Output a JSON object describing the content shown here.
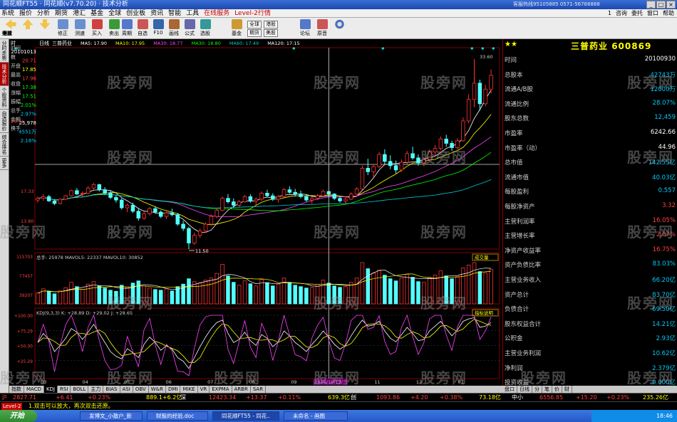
{
  "titlebar": {
    "title": "同花顺FT55 · 同花顺(v7.70.20) · 技术分析",
    "right_text": "客服热线95105885 0571-56768888",
    "min": "_",
    "max": "□",
    "close": "×"
  },
  "menubar": {
    "items": [
      "系统",
      "报价",
      "分析",
      "期货",
      "港汇",
      "基金",
      "全球",
      "创业板",
      "资讯",
      "智能",
      "工具",
      "在线服务",
      "Level-2行情"
    ],
    "right": [
      "1",
      "咨询",
      "委托",
      "窗口",
      "帮助"
    ]
  },
  "toolbar": {
    "buttons": [
      "修正",
      "测速",
      "买入",
      "卖出",
      "周期",
      "自选",
      "F10",
      "画线",
      "公式",
      "选股",
      "",
      "基金",
      "全球",
      "期货",
      "港股",
      "美股",
      "",
      "论坛",
      "原音"
    ],
    "small_pairs": [
      [
        "全球",
        "期货"
      ],
      [
        "港股",
        "美股"
      ]
    ]
  },
  "leftstrip": {
    "tabs": [
      "分时走势",
      "技术分析",
      "个股资料",
      "自选报价",
      "综合排名",
      "更多"
    ]
  },
  "chart": {
    "top_label": "时",
    "period_label": "日线",
    "stock_label": "三普药业",
    "ma_legend": [
      {
        "text": "MA5: 17.90",
        "color": "#ffffff"
      },
      {
        "text": "MA10: 17.95",
        "color": "#ffff00"
      },
      {
        "text": "MA30: 18.77",
        "color": "#ff44ff"
      },
      {
        "text": "MA30: 18.80",
        "color": "#00ff00"
      },
      {
        "text": "MA60: 17.49",
        "color": "#00cccc"
      },
      {
        "text": "MA120: 17:15",
        "color": "#ffffff"
      }
    ],
    "price_hi_label": "33.60",
    "price_axis": [
      "20.71",
      "17.33",
      "13.80"
    ],
    "low_marker": "11.50",
    "info_column": [
      {
        "label": "时间",
        "value": "20101013",
        "color": "#ffffff"
      },
      {
        "label": "数",
        "value": "20.71",
        "color": "#ff4040"
      },
      {
        "label": "开盘",
        "value": "17.85",
        "color": "#ffff00"
      },
      {
        "label": "最高",
        "value": "17.96",
        "color": "#ff4040"
      },
      {
        "label": "收盘",
        "value": "17.38",
        "color": "#00ff00"
      },
      {
        "label": "涨幅",
        "value": "17.51",
        "color": "#00ff00"
      },
      {
        "label": "振幅",
        "value": "2.01%",
        "color": "#00ff00"
      },
      {
        "label": "总手",
        "value": "2.97%",
        "color": "#00ccff"
      },
      {
        "label": "金额",
        "value": "25,978",
        "color": "#ffffff"
      },
      {
        "label": "换手",
        "value": "4551万",
        "color": "#00ccff"
      },
      {
        "label": "",
        "value": "2.16%",
        "color": "#00ccff"
      }
    ],
    "volume": {
      "legend": "总手: 25978 MAVOL5: 22337 MAVOL10: 30852",
      "badge": "成交量",
      "axis": [
        "115703",
        "77457",
        "39207"
      ]
    },
    "kdj": {
      "legend": "KDJ(9,3,3) K: +28.89 D: +29.02 J: +28.65",
      "badge": "指标说明",
      "axis": [
        "+100.00",
        "+75.29",
        "+50.00",
        "+25.29"
      ]
    },
    "date_axis": [
      "03",
      "04",
      "05",
      "06",
      "07",
      "08",
      "09",
      "10",
      "11",
      "12",
      "01"
    ],
    "cursor_date": "2010/10/13/三"
  },
  "chart_data": {
    "type": "candlestick",
    "title": "三普药业 日线",
    "ylim": [
      11.5,
      33.6
    ],
    "note_series": "K线 + MA5/MA10/MA30/MA60/MA120, 成交量, KDJ",
    "candles": [
      [
        17.2,
        17.6,
        16.9,
        17.4
      ],
      [
        17.4,
        17.9,
        17.1,
        17.6
      ],
      [
        17.6,
        17.8,
        17.0,
        17.1
      ],
      [
        17.1,
        17.3,
        16.6,
        16.8
      ],
      [
        16.8,
        17.4,
        16.7,
        17.3
      ],
      [
        17.3,
        17.8,
        17.2,
        17.7
      ],
      [
        17.7,
        18.4,
        17.6,
        18.3
      ],
      [
        18.3,
        18.6,
        17.8,
        17.9
      ],
      [
        17.9,
        18.2,
        17.5,
        18.0
      ],
      [
        18.0,
        18.8,
        17.9,
        18.6
      ],
      [
        18.6,
        19.2,
        18.4,
        19.0
      ],
      [
        19.0,
        19.1,
        18.2,
        18.4
      ],
      [
        18.4,
        18.7,
        17.8,
        18.0
      ],
      [
        18.0,
        18.3,
        17.3,
        17.5
      ],
      [
        17.5,
        17.8,
        16.9,
        17.2
      ],
      [
        17.2,
        17.4,
        16.1,
        16.3
      ],
      [
        16.3,
        16.8,
        15.8,
        16.6
      ],
      [
        16.6,
        16.9,
        15.7,
        15.9
      ],
      [
        15.9,
        16.2,
        14.8,
        15.1
      ],
      [
        15.1,
        15.8,
        14.9,
        15.6
      ],
      [
        15.6,
        16.4,
        15.4,
        16.2
      ],
      [
        16.2,
        16.5,
        15.6,
        15.8
      ],
      [
        15.8,
        16.0,
        15.1,
        15.3
      ],
      [
        15.3,
        15.9,
        15.0,
        15.7
      ],
      [
        15.7,
        16.2,
        15.3,
        15.5
      ],
      [
        15.5,
        15.7,
        14.2,
        14.4
      ],
      [
        14.4,
        14.8,
        13.6,
        13.9
      ],
      [
        13.9,
        14.1,
        11.5,
        12.2
      ],
      [
        12.2,
        13.4,
        12.0,
        13.1
      ],
      [
        13.1,
        13.9,
        12.8,
        13.6
      ],
      [
        13.6,
        14.6,
        13.4,
        14.4
      ],
      [
        14.4,
        15.5,
        14.2,
        15.3
      ],
      [
        15.3,
        16.2,
        15.1,
        16.0
      ],
      [
        16.0,
        17.6,
        15.9,
        17.4
      ],
      [
        17.4,
        17.9,
        16.8,
        17.0
      ],
      [
        17.0,
        17.4,
        16.3,
        16.6
      ],
      [
        16.6,
        17.2,
        16.4,
        17.0
      ],
      [
        17.0,
        17.8,
        16.9,
        17.6
      ],
      [
        17.6,
        17.9,
        16.9,
        17.1
      ],
      [
        17.1,
        17.5,
        16.6,
        17.3
      ],
      [
        17.3,
        18.2,
        17.1,
        18.0
      ],
      [
        18.0,
        18.4,
        17.5,
        17.7
      ],
      [
        17.7,
        18.0,
        17.1,
        17.3
      ],
      [
        17.3,
        17.8,
        16.9,
        17.6
      ],
      [
        17.6,
        18.6,
        17.5,
        18.4
      ],
      [
        18.4,
        18.8,
        17.9,
        18.1
      ],
      [
        18.1,
        18.5,
        17.6,
        17.9
      ],
      [
        17.9,
        18.3,
        17.4,
        17.6
      ],
      [
        17.6,
        17.9,
        17.0,
        17.2
      ],
      [
        17.2,
        17.6,
        16.8,
        17.4
      ],
      [
        17.4,
        17.9,
        17.2,
        17.7
      ],
      [
        17.7,
        18.4,
        17.6,
        18.2
      ],
      [
        18.2,
        18.3,
        17.6,
        17.9
      ],
      [
        17.9,
        18.0,
        17.2,
        17.4
      ],
      [
        17.4,
        17.6,
        16.9,
        17.1
      ],
      [
        17.1,
        17.5,
        16.8,
        17.3
      ],
      [
        17.3,
        18.1,
        17.2,
        17.9
      ],
      [
        17.9,
        18.7,
        17.8,
        18.5
      ],
      [
        18.5,
        21.2,
        18.4,
        20.9
      ],
      [
        20.9,
        22.0,
        20.1,
        20.5
      ],
      [
        20.5,
        21.4,
        19.8,
        21.1
      ],
      [
        21.1,
        22.8,
        20.9,
        22.5
      ],
      [
        22.5,
        23.1,
        21.4,
        21.7
      ],
      [
        21.7,
        22.4,
        20.8,
        21.2
      ],
      [
        21.2,
        21.8,
        20.3,
        20.7
      ],
      [
        20.7,
        21.9,
        20.5,
        21.6
      ],
      [
        21.6,
        22.9,
        21.4,
        22.6
      ],
      [
        22.6,
        23.4,
        21.9,
        22.1
      ],
      [
        22.1,
        22.5,
        21.2,
        21.5
      ],
      [
        21.5,
        22.2,
        21.1,
        21.9
      ],
      [
        21.9,
        23.1,
        21.7,
        22.8
      ],
      [
        22.8,
        23.6,
        22.3,
        23.2
      ],
      [
        23.2,
        24.6,
        23.0,
        24.3
      ],
      [
        24.3,
        24.8,
        23.4,
        23.8
      ],
      [
        23.8,
        24.1,
        22.9,
        23.3
      ],
      [
        23.3,
        24.4,
        23.1,
        24.1
      ],
      [
        24.1,
        26.8,
        24.0,
        26.4
      ],
      [
        26.4,
        29.5,
        26.1,
        28.9
      ],
      [
        28.9,
        33.6,
        28.0,
        30.8
      ],
      [
        30.8,
        31.2,
        27.6,
        28.4
      ],
      [
        28.4,
        30.6,
        28.1,
        30.1
      ],
      [
        30.1,
        32.4,
        29.6,
        31.7
      ]
    ],
    "volume_values": [
      30,
      42,
      35,
      28,
      36,
      45,
      60,
      48,
      40,
      55,
      62,
      50,
      44,
      38,
      35,
      52,
      46,
      58,
      64,
      50,
      44,
      40,
      38,
      42,
      36,
      48,
      55,
      70,
      62,
      58,
      66,
      72,
      85,
      110,
      78,
      60,
      52,
      64,
      56,
      50,
      68,
      58,
      50,
      55,
      72,
      60,
      52,
      48,
      44,
      46,
      54,
      66,
      58,
      50,
      46,
      48,
      60,
      72,
      115,
      98,
      86,
      94,
      80,
      70,
      64,
      72,
      82,
      74,
      62,
      60,
      74,
      80,
      92,
      78,
      70,
      76,
      100,
      108,
      115,
      90,
      86,
      96
    ],
    "kdj_k": [
      55,
      70,
      60,
      40,
      50,
      62,
      78,
      72,
      60,
      72,
      85,
      70,
      55,
      40,
      32,
      28,
      45,
      38,
      30,
      52,
      64,
      55,
      42,
      50,
      44,
      30,
      24,
      12,
      30,
      48,
      64,
      78,
      88,
      92,
      70,
      55,
      60,
      72,
      58,
      50,
      68,
      62,
      48,
      56,
      74,
      66,
      55,
      48,
      40,
      52,
      62,
      74,
      64,
      52,
      44,
      50,
      66,
      80,
      92,
      82,
      84,
      90,
      74,
      62,
      56,
      68,
      80,
      70,
      58,
      60,
      74,
      82,
      90,
      78,
      66,
      76,
      90,
      94,
      96,
      80,
      82,
      88
    ],
    "date_ticks": [
      "03",
      "04",
      "05",
      "06",
      "07",
      "08",
      "09",
      "10",
      "11",
      "12",
      "01"
    ]
  },
  "rightpanel": {
    "stock_title": "三普药业",
    "stock_code": "600869",
    "rows": [
      {
        "label": "时间",
        "value": "20100930",
        "color": "#ffffff"
      },
      {
        "label": "总股本",
        "value": "42743万",
        "color": "#00ccff"
      },
      {
        "label": "流通A/B股",
        "value": "12000万",
        "color": "#00ccff"
      },
      {
        "label": "流通比例",
        "value": "28.07%",
        "color": "#00ccff"
      },
      {
        "label": "股东总数",
        "value": "12,459",
        "color": "#00ccff"
      },
      {
        "label": "市盈率",
        "value": "6242.66",
        "color": "#ffffff"
      },
      {
        "label": "市盈率（动）",
        "value": "44.96",
        "color": "#ffffff"
      },
      {
        "label": "总市值",
        "value": "142.55亿",
        "color": "#00ccff"
      },
      {
        "label": "流通市值",
        "value": "40.03亿",
        "color": "#00ccff"
      },
      {
        "label": "每股盈利",
        "value": "0.557",
        "color": "#00ccff"
      },
      {
        "label": "每股净资产",
        "value": "3.32",
        "color": "#ff4040"
      },
      {
        "label": "主营利润率",
        "value": "16.05%",
        "color": "#ff4040"
      },
      {
        "label": "主营增长率",
        "value": "2.07%",
        "color": "#ff4040"
      },
      {
        "label": "净资产收益率",
        "value": "16.75%",
        "color": "#ff4040"
      },
      {
        "label": "资产负债比率",
        "value": "83.03%",
        "color": "#00ccff"
      },
      {
        "label": "主营业务收入",
        "value": "66.20亿",
        "color": "#00ccff"
      },
      {
        "label": "资产总计",
        "value": "83.70亿",
        "color": "#00ccff"
      },
      {
        "label": "负债合计",
        "value": "69.50亿",
        "color": "#00ccff"
      },
      {
        "label": "股东权益合计",
        "value": "14.21亿",
        "color": "#00ccff"
      },
      {
        "label": "公积金",
        "value": "2.93亿",
        "color": "#00ccff"
      },
      {
        "label": "主营业务利润",
        "value": "10.62亿",
        "color": "#00ccff"
      },
      {
        "label": "净利润",
        "value": "2.379亿",
        "color": "#00ccff"
      },
      {
        "label": "投资收益",
        "value": "-0.000亿",
        "color": "#00ccff"
      }
    ]
  },
  "bottomtabs": [
    "指数",
    "MACD",
    "KDJ",
    "RSI",
    "BOLL",
    "主力",
    "BIAS",
    "ASI",
    "OBV",
    "W&R",
    "DMI",
    "MIKE",
    "VR",
    "EXPMA",
    "ARBR",
    "SAR"
  ],
  "righttabs": [
    "盘口",
    "日线",
    "分",
    "笔",
    "价",
    "财"
  ],
  "indexbar": {
    "sh_label": "沪",
    "sh_val": "2827.71",
    "sh_chg": "+6.41",
    "sh_pct": "+0.23%",
    "sh_amt": "889.1+6.2亿",
    "sz_label": "深",
    "sz_val": "12423.34",
    "sz_chg": "+13.37",
    "sz_pct": "+0.11%",
    "sz_amt": "639.3亿",
    "cy_label": "创",
    "cy_val": "1093.86",
    "cy_chg": "+4.20",
    "cy_pct": "+0.38%",
    "cy_amt": "73.18亿",
    "zx_label": "中小",
    "zx_val": "6556.85",
    "zx_chg": "+15.20",
    "zx_pct": "+0.23%",
    "zx_amt": "235.26亿"
  },
  "statusbar": {
    "text": "1.双击可以放大，再次双击还原。",
    "left_label": "Level-2"
  },
  "taskbar": {
    "start": "开始",
    "tasks": [
      "发博文_小散户_新",
      "财股的经验.doc",
      "同花顺FT55 - 同花..",
      "未命名 - 画图"
    ],
    "clock": "18:46"
  },
  "colors": {
    "up": "#ff3232",
    "down": "#54ffff",
    "accent": "#c00000"
  },
  "watermark": "股旁网"
}
